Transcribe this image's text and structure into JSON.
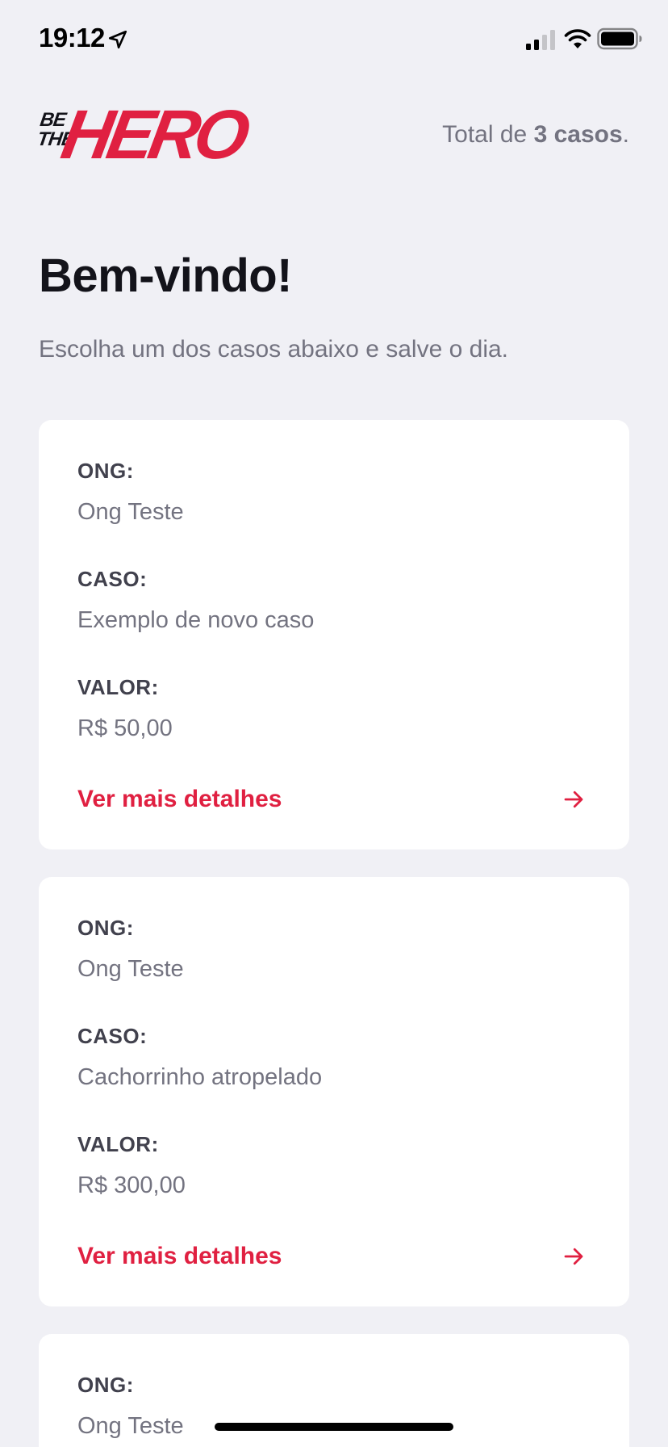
{
  "status_bar": {
    "time": "19:12"
  },
  "header": {
    "logo_small": "BE THE",
    "logo_big": "HERO",
    "total_prefix": "Total de ",
    "total_count": "3 casos",
    "total_suffix": "."
  },
  "main": {
    "title": "Bem-vindo!",
    "description": "Escolha um dos casos abaixo e salve o dia."
  },
  "incidents": [
    {
      "ong_label": "ONG:",
      "ong": "Ong Teste",
      "caso_label": "CASO:",
      "caso": "Exemplo de novo caso",
      "valor_label": "VALOR:",
      "valor": "R$ 50,00",
      "button": "Ver mais detalhes"
    },
    {
      "ong_label": "ONG:",
      "ong": "Ong Teste",
      "caso_label": "CASO:",
      "caso": "Cachorrinho atropelado",
      "valor_label": "VALOR:",
      "valor": "R$ 300,00",
      "button": "Ver mais detalhes"
    },
    {
      "ong_label": "ONG:",
      "ong": "Ong Teste"
    }
  ],
  "colors": {
    "accent": "#e02041",
    "background": "#f0f0f5",
    "card": "#ffffff",
    "label": "#41414d",
    "muted": "#737380"
  }
}
